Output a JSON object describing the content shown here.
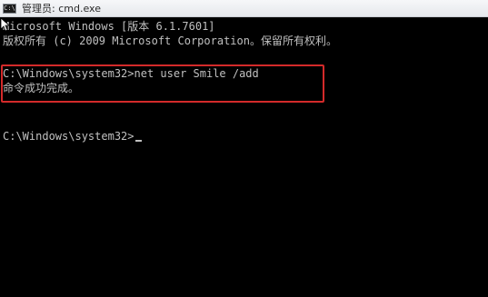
{
  "window": {
    "title": "管理员: cmd.exe",
    "icon_name": "cmd-icon",
    "icon_glyph": "C:\\"
  },
  "console": {
    "lines": [
      "Microsoft Windows [版本 6.1.7601]",
      "版权所有 (c) 2009 Microsoft Corporation。保留所有权利。",
      "C:\\Windows\\system32>net user Smile /add",
      "命令成功完成。",
      "C:\\Windows\\system32>"
    ],
    "text_color": "#c0c0c0",
    "background_color": "#000000"
  },
  "annotation": {
    "highlight_color": "#d42a2a"
  }
}
